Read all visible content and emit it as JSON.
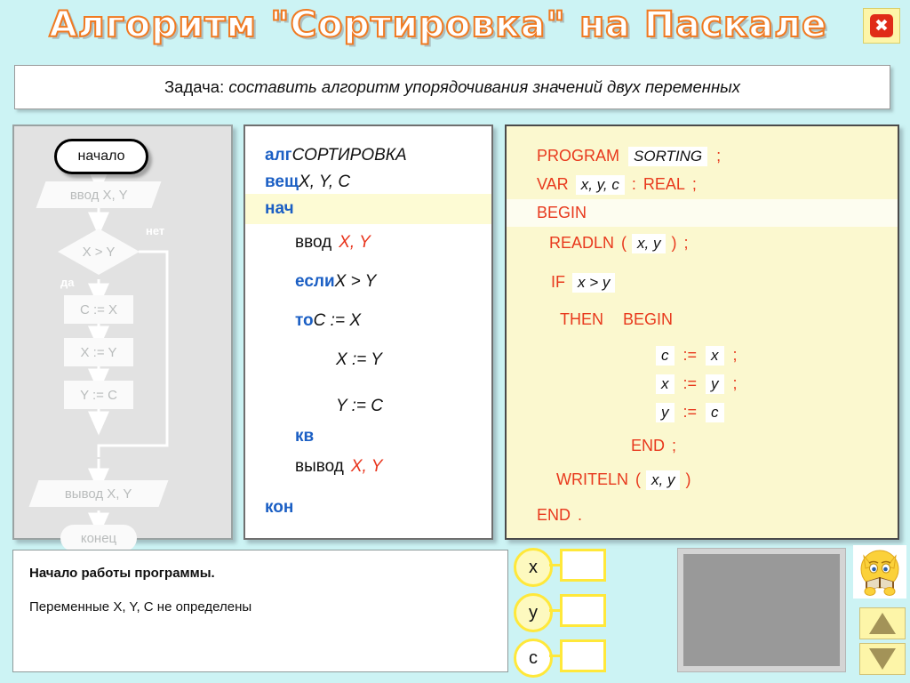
{
  "window": {
    "title": "Алгоритм \"Сортировка\" на Паскале",
    "close_label": "✖",
    "title_outline_color": "#f07a22",
    "background_color": "#ccf3f4"
  },
  "task_banner": {
    "lead": "Задача:",
    "text": " составить  алгоритм  упорядочивания  значений  двух  переменных"
  },
  "flowchart": {
    "nodes": [
      {
        "id": "start",
        "label": "начало",
        "shape": "terminator",
        "active": true
      },
      {
        "id": "input",
        "label": "ввод  X, Y",
        "shape": "parallelogram",
        "active": false
      },
      {
        "id": "cond",
        "label": "X > Y",
        "shape": "diamond",
        "active": false
      },
      {
        "id": "a1",
        "label": "C := X",
        "shape": "rect",
        "active": false
      },
      {
        "id": "a2",
        "label": "X := Y",
        "shape": "rect",
        "active": false
      },
      {
        "id": "a3",
        "label": "Y := C",
        "shape": "rect",
        "active": false
      },
      {
        "id": "output",
        "label": "вывод  X, Y",
        "shape": "parallelogram",
        "active": false
      },
      {
        "id": "end",
        "label": "конец",
        "shape": "terminator",
        "active": false
      }
    ],
    "branch_labels": {
      "yes": "да",
      "no": "нет"
    }
  },
  "algorithm": {
    "lines": [
      {
        "kw": "алг",
        "text": " СОРТИРОВКА",
        "style": "italic",
        "indent": 0,
        "highlight": false
      },
      {
        "kw": "вещ",
        "text": " X, Y, C",
        "style": "italic",
        "indent": 0,
        "highlight": false
      },
      {
        "kw": "нач",
        "text": "",
        "style": "plain",
        "indent": 0,
        "highlight": true
      },
      {
        "kw": "",
        "text": "ввод ",
        "red": "X, Y",
        "indent": 1,
        "highlight": false
      },
      {
        "kw": "если",
        "text": " X > Y",
        "style": "italic",
        "indent": 1,
        "highlight": false
      },
      {
        "kw": "то",
        "text": " C := X",
        "style": "italic",
        "indent": 1,
        "highlight": false
      },
      {
        "kw": "",
        "text": "X := Y",
        "style": "italic",
        "indent": 2,
        "highlight": false
      },
      {
        "kw": "",
        "text": "Y := C",
        "style": "italic",
        "indent": 2,
        "highlight": false
      },
      {
        "kw": "кв",
        "text": "",
        "style": "plain",
        "indent": 1,
        "highlight": false
      },
      {
        "kw": "",
        "text": "вывод ",
        "red": "X, Y",
        "indent": 1,
        "highlight": false
      },
      {
        "kw": "кон",
        "text": "",
        "style": "plain",
        "indent": 0,
        "highlight": false
      }
    ],
    "keyword_color": "#1b5fc4",
    "variable_color": "#e8321a"
  },
  "pascal": {
    "keyword_color": "#e8391d",
    "lines": [
      {
        "id": "l1",
        "indent": 0,
        "highlight": false,
        "parts": [
          {
            "t": "kw",
            "v": "PROGRAM"
          },
          {
            "t": "box",
            "v": "SORTING"
          },
          {
            "t": "kw",
            "v": ";"
          }
        ]
      },
      {
        "id": "l2",
        "indent": 0,
        "highlight": false,
        "parts": [
          {
            "t": "kw",
            "v": "VAR"
          },
          {
            "t": "box",
            "v": "x, y, c"
          },
          {
            "t": "kw",
            "v": ":"
          },
          {
            "t": "kw",
            "v": "REAL"
          },
          {
            "t": "kw",
            "v": ";"
          }
        ]
      },
      {
        "id": "l3",
        "indent": 0,
        "highlight": true,
        "parts": [
          {
            "t": "kw",
            "v": "BEGIN"
          }
        ]
      },
      {
        "id": "l4",
        "indent": 1,
        "highlight": false,
        "parts": [
          {
            "t": "kw",
            "v": "READLN"
          },
          {
            "t": "kw",
            "v": "("
          },
          {
            "t": "box",
            "v": "x, y"
          },
          {
            "t": "kw",
            "v": ")"
          },
          {
            "t": "kw",
            "v": ";"
          }
        ]
      },
      {
        "id": "l5",
        "indent": 1,
        "highlight": false,
        "parts": [
          {
            "t": "kw",
            "v": "IF"
          },
          {
            "t": "box",
            "v": "x > y"
          }
        ]
      },
      {
        "id": "l6",
        "indent": 1,
        "highlight": false,
        "parts": [
          {
            "t": "kw",
            "v": "THEN"
          },
          {
            "t": "kw",
            "v": "BEGIN"
          }
        ]
      },
      {
        "id": "l7",
        "indent": 5,
        "highlight": false,
        "parts": [
          {
            "t": "box",
            "v": "c"
          },
          {
            "t": "kw",
            "v": ":="
          },
          {
            "t": "box",
            "v": "x"
          },
          {
            "t": "kw",
            "v": ";"
          }
        ]
      },
      {
        "id": "l8",
        "indent": 5,
        "highlight": false,
        "parts": [
          {
            "t": "box",
            "v": "x"
          },
          {
            "t": "kw",
            "v": ":="
          },
          {
            "t": "box",
            "v": "y"
          },
          {
            "t": "kw",
            "v": ";"
          }
        ]
      },
      {
        "id": "l9",
        "indent": 5,
        "highlight": false,
        "parts": [
          {
            "t": "box",
            "v": "y"
          },
          {
            "t": "kw",
            "v": ":="
          },
          {
            "t": "box",
            "v": "c"
          }
        ]
      },
      {
        "id": "l10",
        "indent": 4,
        "highlight": false,
        "parts": [
          {
            "t": "kw",
            "v": "END"
          },
          {
            "t": "kw",
            "v": ";"
          }
        ]
      },
      {
        "id": "l11",
        "indent": 1,
        "highlight": false,
        "parts": [
          {
            "t": "kw",
            "v": "WRITELN"
          },
          {
            "t": "kw",
            "v": "("
          },
          {
            "t": "box",
            "v": "x, y"
          },
          {
            "t": "kw",
            "v": ")"
          }
        ]
      },
      {
        "id": "l12",
        "indent": 0,
        "highlight": false,
        "parts": [
          {
            "t": "kw",
            "v": "END"
          },
          {
            "t": "kw",
            "v": "."
          }
        ]
      }
    ]
  },
  "console": {
    "line1": "Начало работы программы.",
    "line2": "Переменные X, Y, C   не  определены"
  },
  "variables": [
    {
      "name": "x",
      "value": "",
      "circle_fill": "#fdf9bf"
    },
    {
      "name": "y",
      "value": "",
      "circle_fill": "#fdf9bf"
    },
    {
      "name": "c",
      "value": "",
      "circle_fill": "#ffffff"
    }
  ],
  "output_screen": {
    "color": "#999999"
  },
  "nav": {
    "up_label": "▲",
    "down_label": "▼"
  }
}
